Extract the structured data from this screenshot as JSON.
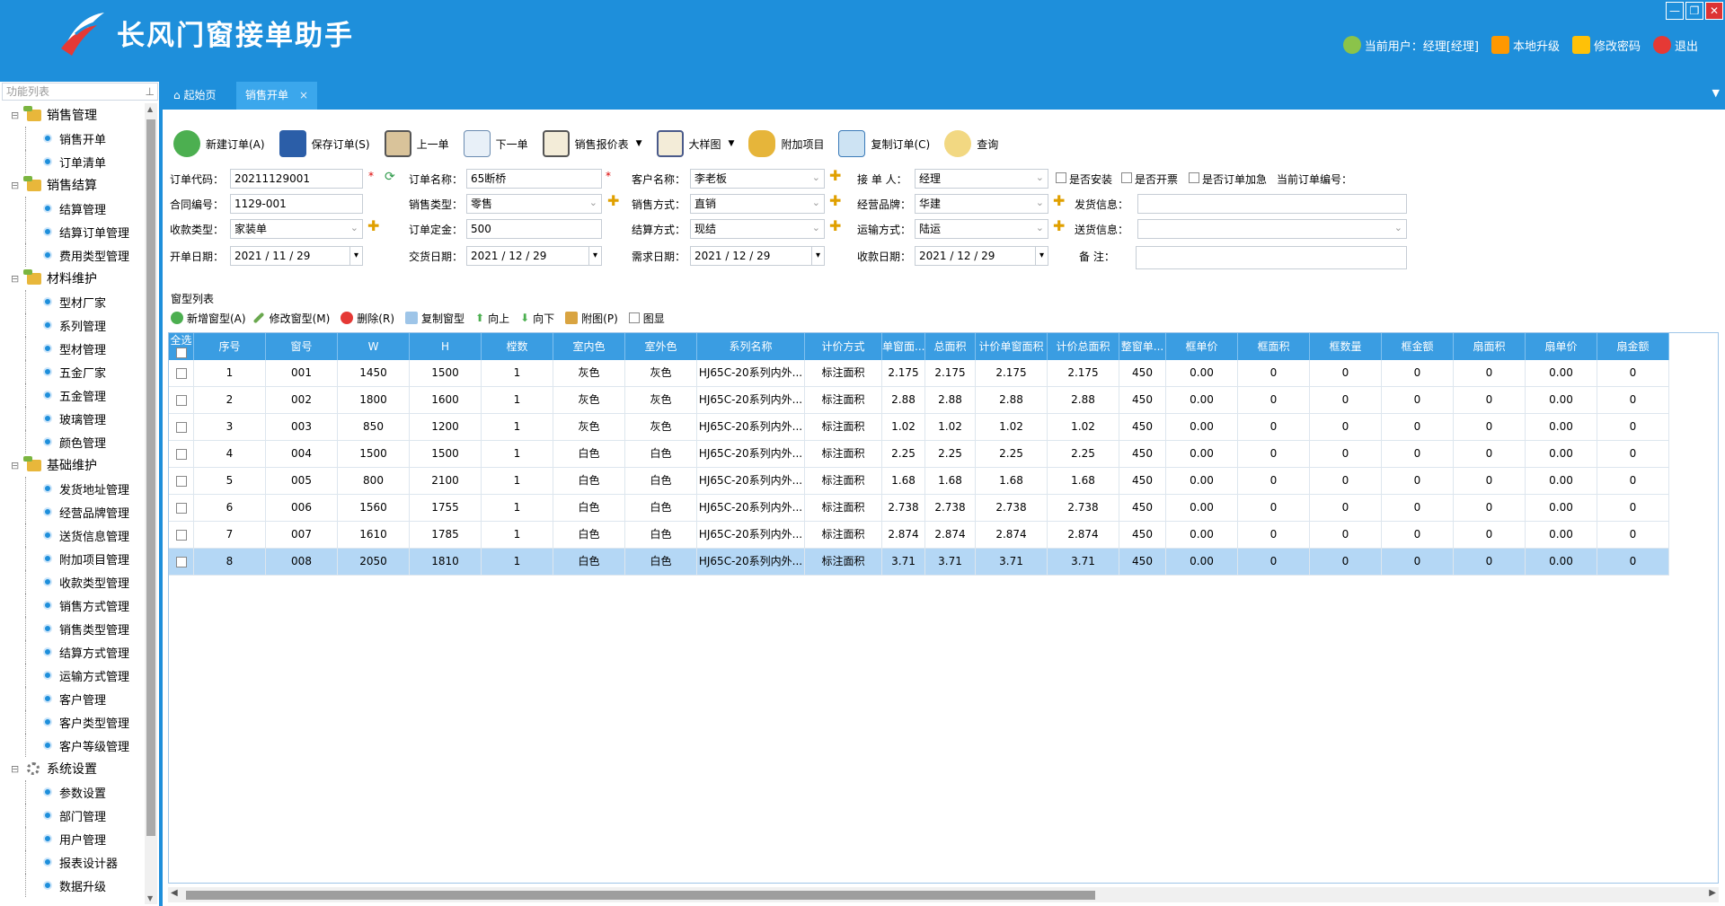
{
  "app": {
    "title": "长风门窗接单助手",
    "window_buttons": [
      "—",
      "❐",
      "✕"
    ],
    "user": {
      "current_user": "当前用户：经理[经理]",
      "upgrade": "本地升级",
      "change_password": "修改密码",
      "logout": "退出"
    }
  },
  "tabs": [
    {
      "label": "起始页",
      "active": false
    },
    {
      "label": "销售开单",
      "active": true
    }
  ],
  "sidebar": {
    "search_placeholder": "功能列表",
    "groups": [
      {
        "label": "销售管理",
        "items": [
          "销售开单",
          "订单清单"
        ]
      },
      {
        "label": "销售结算",
        "items": [
          "结算管理",
          "结算订单管理",
          "费用类型管理"
        ]
      },
      {
        "label": "材料维护",
        "items": [
          "型材厂家",
          "系列管理",
          "型材管理",
          "五金厂家",
          "五金管理",
          "玻璃管理",
          "颜色管理"
        ]
      },
      {
        "label": "基础维护",
        "items": [
          "发货地址管理",
          "经营品牌管理",
          "送货信息管理",
          "附加项目管理",
          "收款类型管理",
          "销售方式管理",
          "销售类型管理",
          "结算方式管理",
          "运输方式管理",
          "客户管理",
          "客户类型管理",
          "客户等级管理"
        ]
      },
      {
        "label": "系统设置",
        "items": [
          "参数设置",
          "部门管理",
          "用户管理",
          "报表设计器",
          "数据升级"
        ]
      }
    ]
  },
  "toolbar": {
    "new_order": "新建订单(A)",
    "save_order": "保存订单(S)",
    "prev": "上一单",
    "next": "下一单",
    "quote": "销售报价表",
    "big_drawing": "大样图",
    "extra_items": "附加项目",
    "copy_order": "复制订单(C)",
    "query": "查询"
  },
  "form": {
    "order_code_label": "订单代码：",
    "order_code": "20211129001",
    "order_name_label": "订单名称：",
    "order_name": "65断桥",
    "customer_label": "客户名称：",
    "customer": "李老板",
    "receiver_label": "接 单 人：",
    "receiver": "经理",
    "install_label": "是否安装",
    "invoice_label": "是否开票",
    "urgent_label": "是否订单加急",
    "current_order_label": "当前订单编号：",
    "contract_label": "合同编号：",
    "contract": "1129-001",
    "sale_type_label": "销售类型：",
    "sale_type": "零售",
    "sale_method_label": "销售方式：",
    "sale_method": "直销",
    "brand_label": "经营品牌：",
    "brand": "华建",
    "ship_info_label": "发货信息：",
    "ship_info": "",
    "pay_type_label": "收款类型：",
    "pay_type": "家装单",
    "deposit_label": "订单定金：",
    "deposit": "500",
    "settle_label": "结算方式：",
    "settle": "现结",
    "transport_label": "运输方式：",
    "transport": "陆运",
    "delivery_label": "送货信息：",
    "delivery": "",
    "open_date_label": "开单日期：",
    "open_date": "2021 / 11 / 29",
    "deliver_date_label": "交货日期：",
    "deliver_date": "2021 / 12 / 29",
    "need_date_label": "需求日期：",
    "need_date": "2021 / 12 / 29",
    "collect_date_label": "收款日期：",
    "collect_date": "2021 / 12 / 29",
    "remark_label": "备    注：",
    "remark": ""
  },
  "window_list": {
    "title": "窗型列表",
    "tools": {
      "add": "新增窗型(A)",
      "edit": "修改窗型(M)",
      "delete": "删除(R)",
      "copy": "复制窗型",
      "up": "向上",
      "down": "向下",
      "attach": "附图(P)",
      "show_image": "图显"
    },
    "columns": [
      "全选",
      "序号",
      "窗号",
      "W",
      "H",
      "樘数",
      "室内色",
      "室外色",
      "系列名称",
      "计价方式",
      "单窗面...",
      "总面积",
      "计价单窗面积",
      "计价总面积",
      "整窗单...",
      "框单价",
      "框面积",
      "框数量",
      "框金额",
      "扇面积",
      "扇单价",
      "扇金额"
    ],
    "rows": [
      [
        "",
        "1",
        "001",
        "1450",
        "1500",
        "1",
        "灰色",
        "灰色",
        "HJ65C-20系列内外...",
        "标注面积",
        "2.175",
        "2.175",
        "2.175",
        "2.175",
        "450",
        "0.00",
        "0",
        "0",
        "0",
        "0",
        "0.00",
        "0"
      ],
      [
        "",
        "2",
        "002",
        "1800",
        "1600",
        "1",
        "灰色",
        "灰色",
        "HJ65C-20系列内外...",
        "标注面积",
        "2.88",
        "2.88",
        "2.88",
        "2.88",
        "450",
        "0.00",
        "0",
        "0",
        "0",
        "0",
        "0.00",
        "0"
      ],
      [
        "",
        "3",
        "003",
        "850",
        "1200",
        "1",
        "灰色",
        "灰色",
        "HJ65C-20系列内外...",
        "标注面积",
        "1.02",
        "1.02",
        "1.02",
        "1.02",
        "450",
        "0.00",
        "0",
        "0",
        "0",
        "0",
        "0.00",
        "0"
      ],
      [
        "",
        "4",
        "004",
        "1500",
        "1500",
        "1",
        "白色",
        "白色",
        "HJ65C-20系列内外...",
        "标注面积",
        "2.25",
        "2.25",
        "2.25",
        "2.25",
        "450",
        "0.00",
        "0",
        "0",
        "0",
        "0",
        "0.00",
        "0"
      ],
      [
        "",
        "5",
        "005",
        "800",
        "2100",
        "1",
        "白色",
        "白色",
        "HJ65C-20系列内外...",
        "标注面积",
        "1.68",
        "1.68",
        "1.68",
        "1.68",
        "450",
        "0.00",
        "0",
        "0",
        "0",
        "0",
        "0.00",
        "0"
      ],
      [
        "",
        "6",
        "006",
        "1560",
        "1755",
        "1",
        "白色",
        "白色",
        "HJ65C-20系列内外...",
        "标注面积",
        "2.738",
        "2.738",
        "2.738",
        "2.738",
        "450",
        "0.00",
        "0",
        "0",
        "0",
        "0",
        "0.00",
        "0"
      ],
      [
        "",
        "7",
        "007",
        "1610",
        "1785",
        "1",
        "白色",
        "白色",
        "HJ65C-20系列内外...",
        "标注面积",
        "2.874",
        "2.874",
        "2.874",
        "2.874",
        "450",
        "0.00",
        "0",
        "0",
        "0",
        "0",
        "0.00",
        "0"
      ],
      [
        "",
        "8",
        "008",
        "2050",
        "1810",
        "1",
        "白色",
        "白色",
        "HJ65C-20系列内外...",
        "标注面积",
        "3.71",
        "3.71",
        "3.71",
        "3.71",
        "450",
        "0.00",
        "0",
        "0",
        "0",
        "0",
        "0.00",
        "0"
      ]
    ],
    "selected_row": 7
  },
  "colors": {
    "accent": "#1e8fdb",
    "header_row": "#3a9de2",
    "selected_row": "#b4d7f5"
  }
}
